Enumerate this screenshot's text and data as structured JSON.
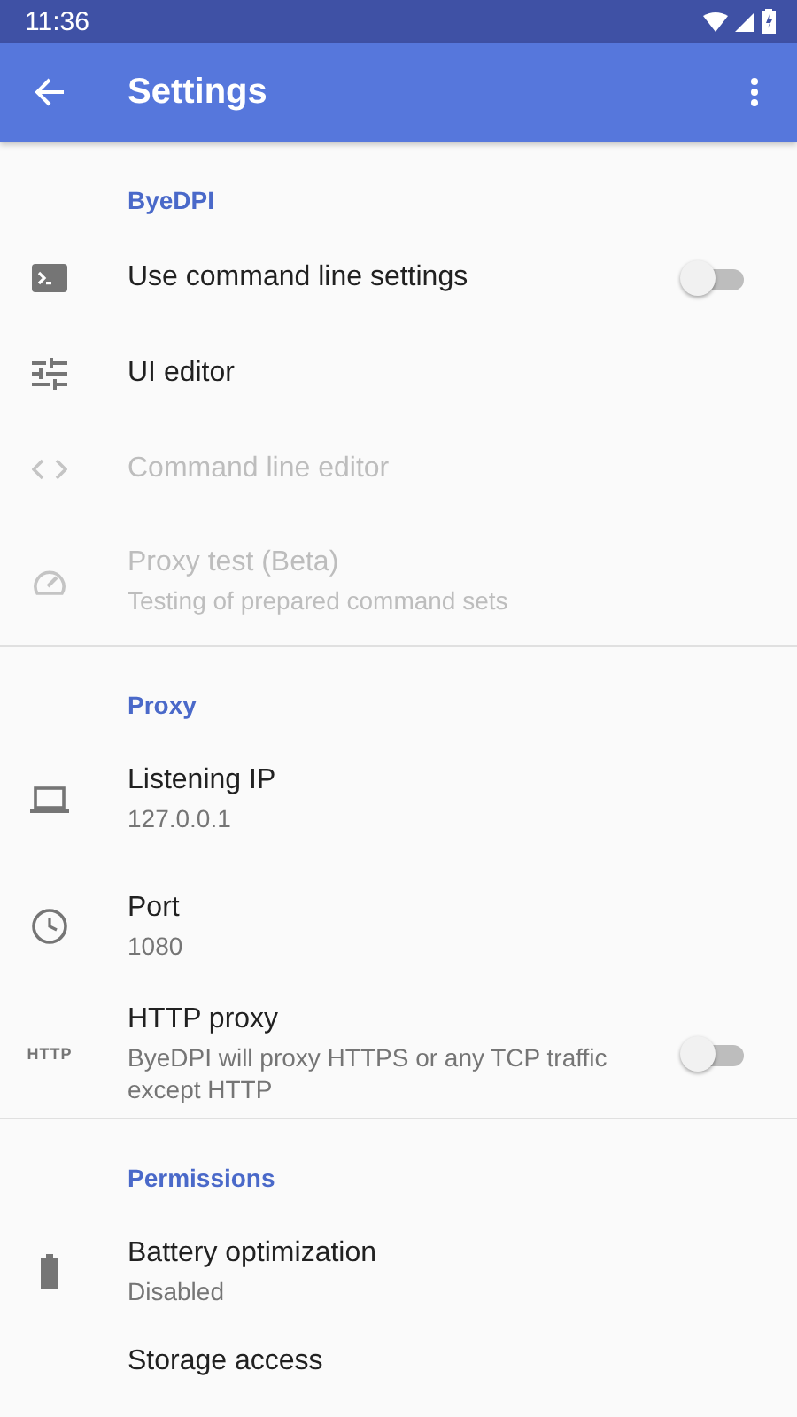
{
  "status_bar": {
    "time": "11:36"
  },
  "app_bar": {
    "title": "Settings"
  },
  "sections": [
    {
      "title": "ByeDPI",
      "items": [
        {
          "kind": "switch",
          "title": "Use command line settings",
          "disabled": false,
          "on": false
        },
        {
          "kind": "plain",
          "title": "UI editor",
          "disabled": false
        },
        {
          "kind": "plain",
          "title": "Command line editor",
          "disabled": true
        },
        {
          "kind": "plain",
          "title": "Proxy test (Beta)",
          "summary": "Testing of prepared command sets",
          "disabled": true
        }
      ]
    },
    {
      "title": "Proxy",
      "items": [
        {
          "kind": "plain",
          "title": "Listening IP",
          "summary": "127.0.0.1",
          "disabled": false
        },
        {
          "kind": "plain",
          "title": "Port",
          "summary": "1080",
          "disabled": false
        },
        {
          "kind": "switch",
          "icon_text": "HTTP",
          "title": "HTTP proxy",
          "summary": "ByeDPI will proxy HTTPS or any TCP traffic except HTTP",
          "disabled": false,
          "on": false
        }
      ]
    },
    {
      "title": "Permissions",
      "items": [
        {
          "kind": "plain",
          "title": "Battery optimization",
          "summary": "Disabled",
          "disabled": false
        },
        {
          "kind": "plain",
          "title": "Storage access",
          "disabled": false
        }
      ]
    }
  ]
}
